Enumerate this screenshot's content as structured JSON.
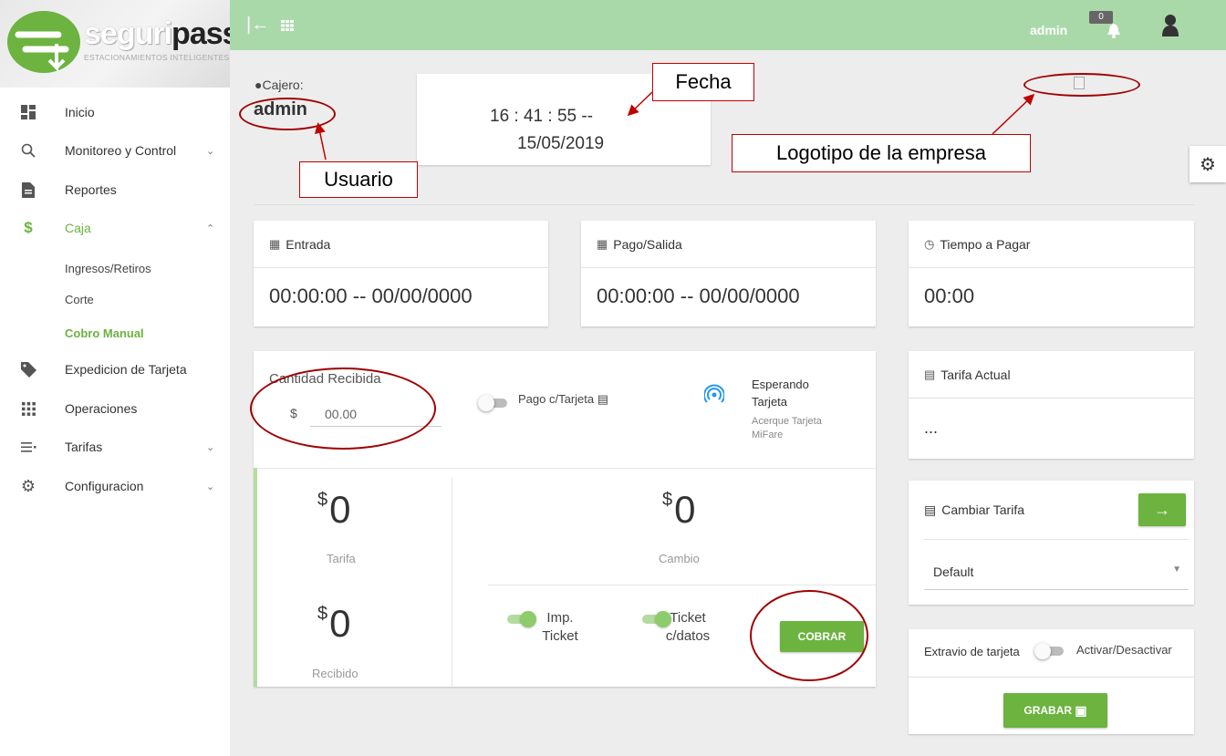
{
  "brand": {
    "name_part1": "seguri",
    "name_part2": "pass",
    "tagline": "ESTACIONAMIENTOS INTELIGENTES"
  },
  "sidebar": {
    "items": [
      {
        "label": "Inicio",
        "icon": "dashboard-icon"
      },
      {
        "label": "Monitoreo y Control",
        "icon": "search-icon"
      },
      {
        "label": "Reportes",
        "icon": "document-icon"
      },
      {
        "label": "Caja",
        "icon": "dollar-icon"
      },
      {
        "label": "Expedicion de Tarjeta",
        "icon": "tag-icon"
      },
      {
        "label": "Operaciones",
        "icon": "apps-icon"
      },
      {
        "label": "Tarifas",
        "icon": "list-icon"
      },
      {
        "label": "Configuracion",
        "icon": "gear-icon"
      }
    ],
    "caja_sub": [
      "Ingresos/Retiros",
      "Corte",
      "Cobro Manual"
    ]
  },
  "topbar": {
    "user": "admin",
    "notifications": "0"
  },
  "cajero": {
    "label": "Cajero:",
    "name": "admin"
  },
  "clock": {
    "time": "16 : 41 : 55 --",
    "date": "15/05/2019"
  },
  "annotations": {
    "fecha": "Fecha",
    "usuario": "Usuario",
    "logo": "Logotipo de la empresa"
  },
  "entrada": {
    "title": "Entrada",
    "value": "00:00:00 -- 00/00/0000"
  },
  "pago_salida": {
    "title": "Pago/Salida",
    "value": "00:00:00 -- 00/00/0000"
  },
  "tiempo": {
    "title": "Tiempo a Pagar",
    "value": "00:00"
  },
  "payment": {
    "cantidad_label": "Cantidad Recibida",
    "currency": "$",
    "cantidad_value": "00.00",
    "pago_tarjeta": "Pago c/Tarjeta",
    "status_title": "Esperando Tarjeta",
    "status_sub": "Acerque Tarjeta MiFare",
    "tarifa_value": "0",
    "tarifa_label": "Tarifa",
    "recibido_value": "0",
    "recibido_label": "Recibido",
    "cambio_value": "0",
    "cambio_label": "Cambio",
    "imp_ticket": "Imp. Ticket",
    "ticket_datos": "Ticket c/datos",
    "cobrar": "COBRAR"
  },
  "tarifa_actual": {
    "title": "Tarifa Actual",
    "value": "..."
  },
  "cambiar_tarifa": {
    "title": "Cambiar Tarifa",
    "selected": "Default"
  },
  "extravio": {
    "title": "Extravio de tarjeta",
    "toggle_label": "Activar/Desactivar",
    "grabar": "GRABAR"
  },
  "colors": {
    "accent": "#6cb33f",
    "topbar": "#a9d9a9",
    "annotation": "#c00000"
  }
}
